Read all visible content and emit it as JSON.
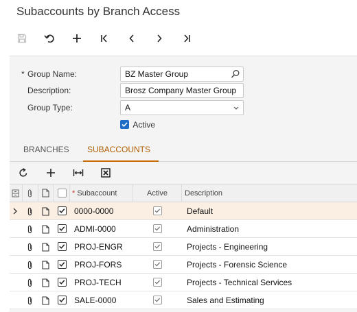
{
  "page": {
    "title": "Subaccounts by Branch Access"
  },
  "toolbar": {
    "buttons": [
      {
        "name": "save-button",
        "icon": "save-icon"
      },
      {
        "name": "undo-button",
        "icon": "undo-icon"
      },
      {
        "name": "add-button",
        "icon": "plus-icon"
      },
      {
        "name": "first-record-button",
        "icon": "first-icon"
      },
      {
        "name": "previous-record-button",
        "icon": "previous-icon"
      },
      {
        "name": "next-record-button",
        "icon": "next-icon"
      },
      {
        "name": "last-record-button",
        "icon": "last-icon"
      }
    ]
  },
  "form": {
    "required_marker": "*",
    "group_name_label": "Group Name:",
    "group_name_value": "BZ Master Group",
    "description_label": "Description:",
    "description_value": "Brosz Company Master Group",
    "group_type_label": "Group Type:",
    "group_type_value": "A",
    "active_label": "Active",
    "active_checked": true
  },
  "tabs": [
    {
      "label": "BRANCHES",
      "active": false
    },
    {
      "label": "SUBACCOUNTS",
      "active": true
    }
  ],
  "grid_toolbar": {
    "buttons": [
      "refresh-icon",
      "plus-icon",
      "fit-columns-icon",
      "export-excel-icon"
    ]
  },
  "grid": {
    "columns": {
      "subaccount": "Subaccount",
      "active": "Active",
      "description": "Description"
    },
    "rows": [
      {
        "subaccount": "0000-0000",
        "active": true,
        "description": "Default",
        "selected": true
      },
      {
        "subaccount": "ADMI-0000",
        "active": true,
        "description": "Administration",
        "selected": false
      },
      {
        "subaccount": "PROJ-ENGR",
        "active": true,
        "description": "Projects - Engineering",
        "selected": false
      },
      {
        "subaccount": "PROJ-FORS",
        "active": true,
        "description": "Projects - Forensic Science",
        "selected": false
      },
      {
        "subaccount": "PROJ-TECH",
        "active": true,
        "description": "Projects - Technical Services",
        "selected": false
      },
      {
        "subaccount": "SALE-0000",
        "active": true,
        "description": "Sales and Estimating",
        "selected": false
      }
    ]
  },
  "colors": {
    "accent": "#c96b00",
    "checkbox_blue": "#1f6cc8",
    "selected_row": "#fbefe4",
    "panel_bg": "#f4f4f4"
  }
}
